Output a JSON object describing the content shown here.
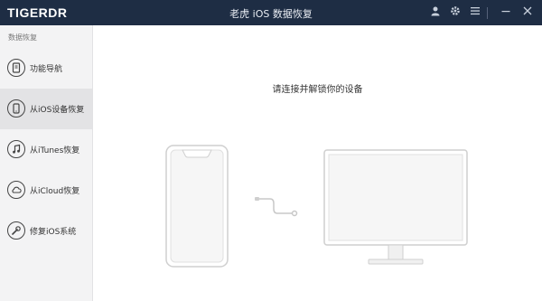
{
  "titlebar": {
    "logo": "TIGERDR",
    "title": "老虎 iOS 数据恢复",
    "icons": [
      "user-icon",
      "settings-icon",
      "menu-icon",
      "minimize-icon",
      "close-icon"
    ]
  },
  "sidebar": {
    "header": "数据恢复",
    "items": [
      {
        "label": "功能导航",
        "icon": "navigation-icon",
        "active": false
      },
      {
        "label": "从iOS设备恢复",
        "icon": "phone-icon",
        "active": true
      },
      {
        "label": "从iTunes恢复",
        "icon": "music-note-icon",
        "active": false
      },
      {
        "label": "从iCloud恢复",
        "icon": "cloud-icon",
        "active": false
      },
      {
        "label": "修复iOS系统",
        "icon": "wrench-icon",
        "active": false
      }
    ]
  },
  "main": {
    "prompt": "请连接并解锁你的设备"
  },
  "colors": {
    "titlebar_bg": "#1e2d44",
    "sidebar_bg": "#f3f3f4",
    "active_item_bg": "#e3e3e5",
    "illustration_stroke": "#cfcfcf"
  }
}
